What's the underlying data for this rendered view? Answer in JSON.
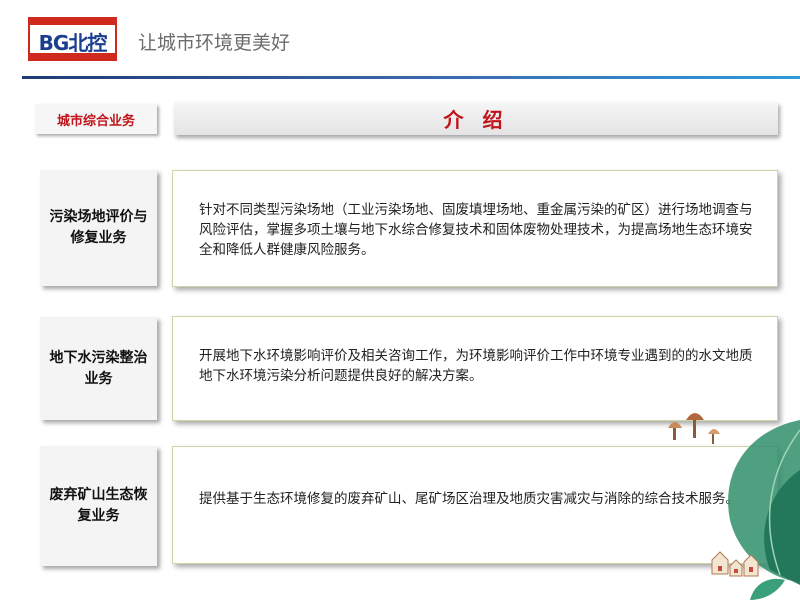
{
  "header": {
    "logo_text": "BG北控",
    "slogan": "让城市环境更美好"
  },
  "category_tab": "城市综合业务",
  "intro_header": "介 绍",
  "rows": [
    {
      "label": "污染场地评价与修复业务",
      "description": "针对不同类型污染场地（工业污染场地、固废填埋场地、重金属污染的矿区）进行场地调查与风险评估，掌握多项土壤与地下水综合修复技术和固体废物处理技术，为提高场地生态环境安全和降低人群健康风险服务。"
    },
    {
      "label": "地下水污染整治业务",
      "description": "开展地下水环境影响评价及相关咨询工作，为环境影响评价工作中环境专业遇到的的水文地质地下水环境污染分析问题提供良好的解决方案。"
    },
    {
      "label": "废弃矿山生态恢复业务",
      "description": "提供基于生态环境修复的废弃矿山、尾矿场区治理及地质灾害减灾与消除的综合技术服务。"
    }
  ],
  "colors": {
    "accent_red": "#c0141a",
    "logo_blue": "#1b3f8f",
    "header_line": "#2e6fb5",
    "leaf_green": "#2f8f6a"
  }
}
